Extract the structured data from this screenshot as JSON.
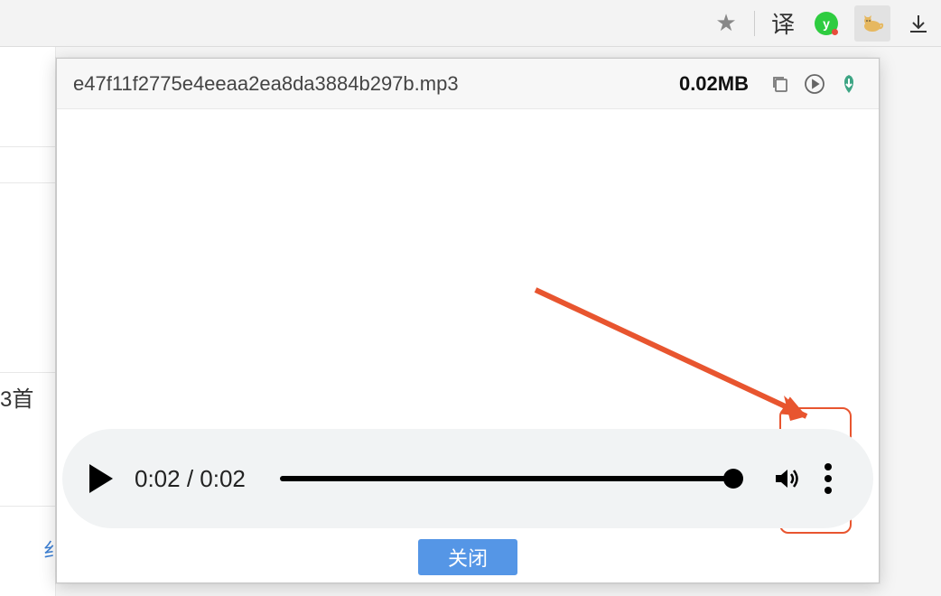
{
  "toolbar": {
    "translate_label": "译",
    "green_badge_letter": "y"
  },
  "popup": {
    "filename": "e47f11f2775e4eeaa2ea8da3884b297b.mp3",
    "filesize": "0.02MB",
    "close_label": "关闭"
  },
  "player": {
    "current_time": "0:02",
    "total_time": "0:02",
    "time_separator": " / ",
    "progress_percent": 100
  },
  "background": {
    "partial_text_1": "3首",
    "partial_text_2": "纟"
  },
  "colors": {
    "annotation_red": "#e8552f",
    "button_blue": "#5596e6",
    "green_badge": "#2ecc40"
  }
}
